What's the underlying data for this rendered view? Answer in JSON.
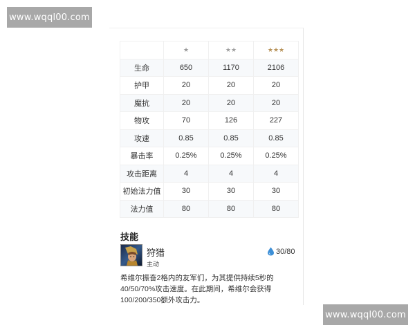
{
  "watermarks": {
    "top": "www.wqql00.com",
    "bottom": "www.wqql00.com"
  },
  "stats": {
    "star_headers": [
      "★",
      "★★",
      "★★★"
    ],
    "rows": [
      {
        "label": "生命",
        "values": [
          "650",
          "1170",
          "2106"
        ]
      },
      {
        "label": "护甲",
        "values": [
          "20",
          "20",
          "20"
        ]
      },
      {
        "label": "魔抗",
        "values": [
          "20",
          "20",
          "20"
        ]
      },
      {
        "label": "物攻",
        "values": [
          "70",
          "126",
          "227"
        ]
      },
      {
        "label": "攻速",
        "values": [
          "0.85",
          "0.85",
          "0.85"
        ]
      },
      {
        "label": "暴击率",
        "values": [
          "0.25%",
          "0.25%",
          "0.25%"
        ]
      },
      {
        "label": "攻击距离",
        "values": [
          "4",
          "4",
          "4"
        ]
      },
      {
        "label": "初始法力值",
        "values": [
          "30",
          "30",
          "30"
        ]
      },
      {
        "label": "法力值",
        "values": [
          "80",
          "80",
          "80"
        ]
      }
    ]
  },
  "skills": {
    "title": "技能",
    "name": "狩猎",
    "type": "主动",
    "mana": "30/80",
    "description": "希维尔振奋2格内的友军们，为其提供持续5秒的40/50/70%攻击速度。在此期间，希维尔会获得100/200/350额外攻击力。"
  },
  "colors": {
    "star_one": "#9a9a9a",
    "star_two": "#a0a0a0",
    "star_three": "#b8935a",
    "mana_drop": "#3d8fd6",
    "watermark_bg": "#a8a8a8"
  }
}
